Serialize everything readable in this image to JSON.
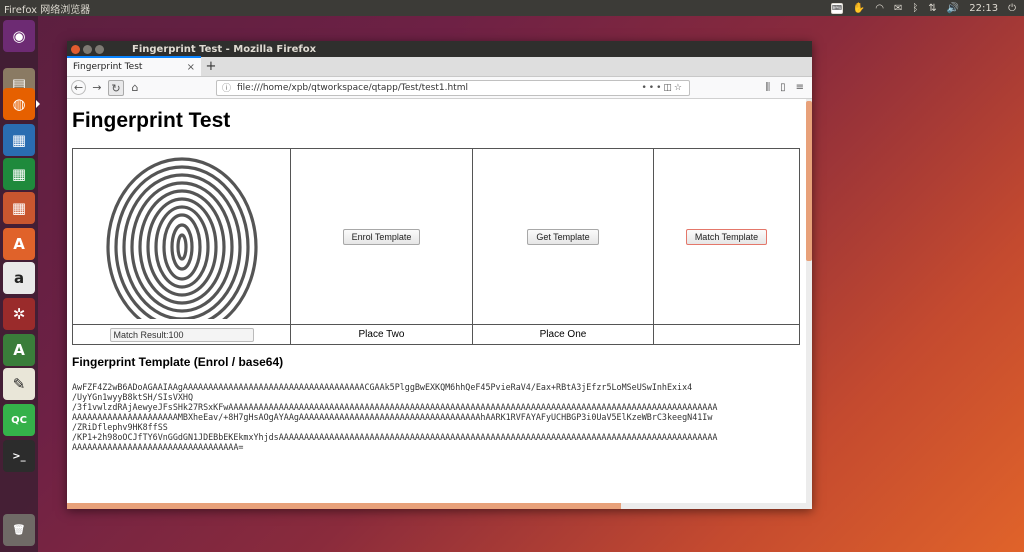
{
  "top_panel": {
    "app_name": "Firefox 网络浏览器",
    "time": "22:13"
  },
  "window": {
    "title": "Fingerprint Test - Mozilla Firefox"
  },
  "tab": {
    "label": "Fingerprint Test",
    "close": "×",
    "new_tab": "+"
  },
  "navbar": {
    "url": "file:///home/xpb/qtworkspace/qtapp/Test/test1.html",
    "page_actions": "•••"
  },
  "page": {
    "title": "Fingerprint Test",
    "buttons": {
      "enrol": "Enrol Template",
      "get": "Get Template",
      "match": "Match Template"
    },
    "match_result": "Match Result:100",
    "place_two": "Place Two",
    "place_one": "Place One",
    "section_title": "Fingerprint Template (Enrol / base64)",
    "template_lines": [
      "AwFZF4Z2wB6ADoAGAAIAAgAAAAAAAAAAAAAAAAAAAAAAAAAAAAAAAAAAAACGAAk5PlggBwEXKQM6hhQeF45PvieRaV4/Eax+RBtA3jEfzr5LoMSeUSwInhExix4",
      "/UyYGn1wyyB8ktSH/SIsVXHQ",
      "/3f1vwlzdRAjAewyeJFsSHk27RSxKFwAAAAAAAAAAAAAAAAAAAAAAAAAAAAAAAAAAAAAAAAAAAAAAAAAAAAAAAAAAAAAAAAAAAAAAAAAAAAAAAAAAAAAAAAAAAAAAAAA",
      "AAAAAAAAAAAAAAAAAAAAAMBXheEav/+8H7gHsAOgAYAAgAAAAAAAAAAAAAAAAAAAAAAAAAAAAAAAAAAAAhAARK1RVFAYAFyUCHBGP3i0UaV5ElKzeWBrC3keegN41Iw",
      "/ZRiDflephv9HK8ffSS",
      "/KP1+2h98oOCJfTY6VnGGdGN1JDEBbEKEkmxYhjdsAAAAAAAAAAAAAAAAAAAAAAAAAAAAAAAAAAAAAAAAAAAAAAAAAAAAAAAAAAAAAAAAAAAAAAAAAAAAAAAAAAAAAAA",
      "AAAAAAAAAAAAAAAAAAAAAAAAAAAAAAAAA="
    ]
  },
  "launcher": {
    "items": [
      {
        "name": "ubuntu-dash",
        "glyph": "◉",
        "color": "#6d2b73"
      },
      {
        "name": "files",
        "glyph": "▤",
        "color": "#8a7a63"
      },
      {
        "name": "firefox",
        "glyph": "◍",
        "color": "#e66000"
      },
      {
        "name": "writer",
        "glyph": "▦",
        "color": "#2a6db1"
      },
      {
        "name": "calc",
        "glyph": "▦",
        "color": "#1f8a3c"
      },
      {
        "name": "impress",
        "glyph": "▦",
        "color": "#c8562f"
      },
      {
        "name": "software",
        "glyph": "A",
        "color": "#e0622a"
      },
      {
        "name": "amazon",
        "glyph": "a",
        "color": "#e9e9e9"
      },
      {
        "name": "settings",
        "glyph": "✲",
        "color": "#9a2b2b"
      },
      {
        "name": "updater",
        "glyph": "A",
        "color": "#3a7d3a"
      },
      {
        "name": "text-editor",
        "glyph": "✎",
        "color": "#e9e6d8"
      },
      {
        "name": "qt-creator",
        "glyph": "QC",
        "color": "#35b14a"
      },
      {
        "name": "terminal",
        "glyph": ">_",
        "color": "#2c2c2c"
      },
      {
        "name": "trash",
        "glyph": "🗑",
        "color": "#6f6a66"
      }
    ]
  }
}
